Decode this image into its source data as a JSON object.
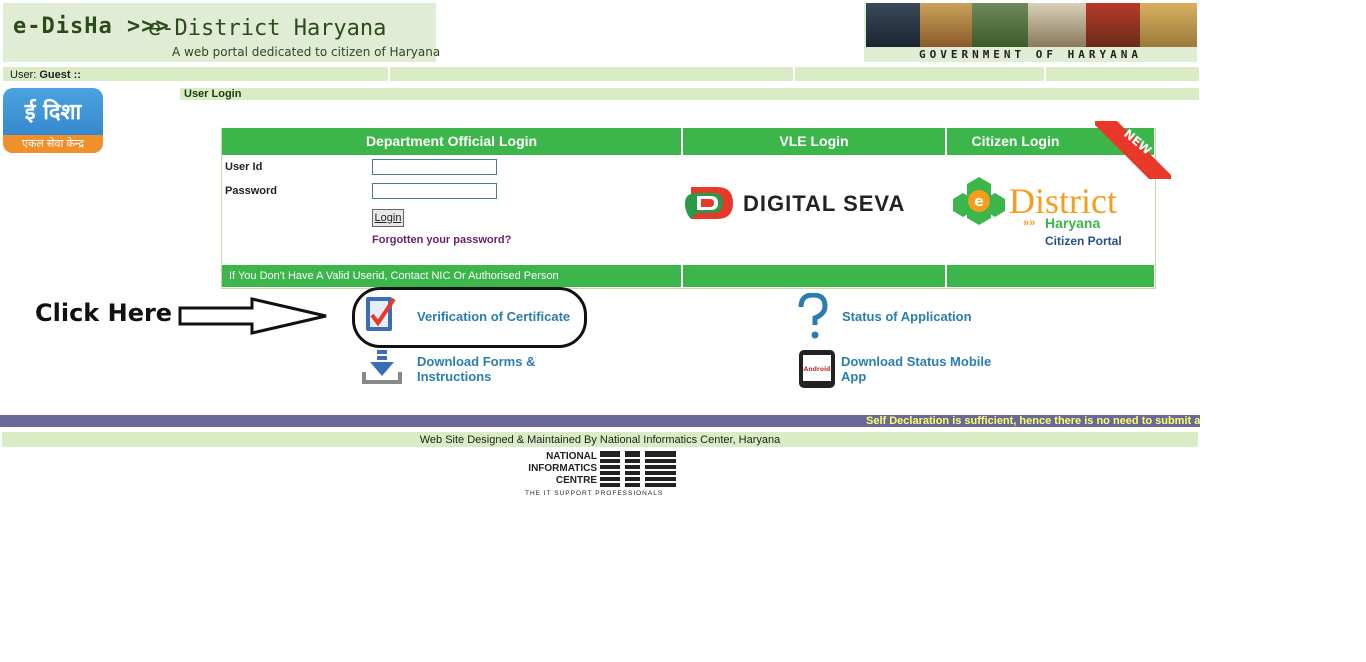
{
  "header": {
    "brand_edisha": "e-DisHa >>>",
    "brand_district": "e-District Haryana",
    "tagline": "A web portal dedicated to citizen of Haryana",
    "government": "GOVERNMENT OF HARYANA"
  },
  "userbar": {
    "user_prefix": "User:",
    "user_name": "Guest ::"
  },
  "section": {
    "user_login": "User Login"
  },
  "logo": {
    "main": "ई दिशा",
    "sub": "एकल सेवा केन्द्र"
  },
  "login": {
    "dept_heading": "Department Official Login",
    "vle_heading": "VLE Login",
    "citizen_heading": "Citizen Login",
    "userid_label": "User Id",
    "password_label": "Password",
    "userid_value": "",
    "password_value": "",
    "login_button": "Login",
    "forgot_link": "Forgotten your password?",
    "footer_note": "If You Don't Have A Valid Userid, Contact NIC Or Authorised Person"
  },
  "vle": {
    "digital_seva": "DIGITAL SEVA"
  },
  "citizen": {
    "district": "District",
    "haryana": "Haryana",
    "portal": "Citizen Portal",
    "new_badge": "NEW"
  },
  "links": {
    "verification": "Verification of Certificate",
    "status": "Status of Application",
    "download_forms": "Download Forms & Instructions",
    "mobile_app": "Download Status Mobile App",
    "android_label": "Android"
  },
  "annotation": {
    "click_here": "Click Here"
  },
  "marquee": {
    "text": "Self Declaration is sufficient, hence there is no need to submit affi"
  },
  "footer": {
    "text": "Web Site Designed & Maintained By National Informatics Center, Haryana",
    "nic_line1": "NATIONAL",
    "nic_line2": "INFORMATICS",
    "nic_line3": "CENTRE",
    "nic_tagline": "THE IT SUPPORT PROFESSIONALS"
  },
  "colors": {
    "header_bg": "#e1ecd4",
    "green_accent": "#3cb54a",
    "link_blue": "#2a7db0",
    "marquee_bg": "#6a6a9a",
    "marquee_text": "#ffff66"
  }
}
